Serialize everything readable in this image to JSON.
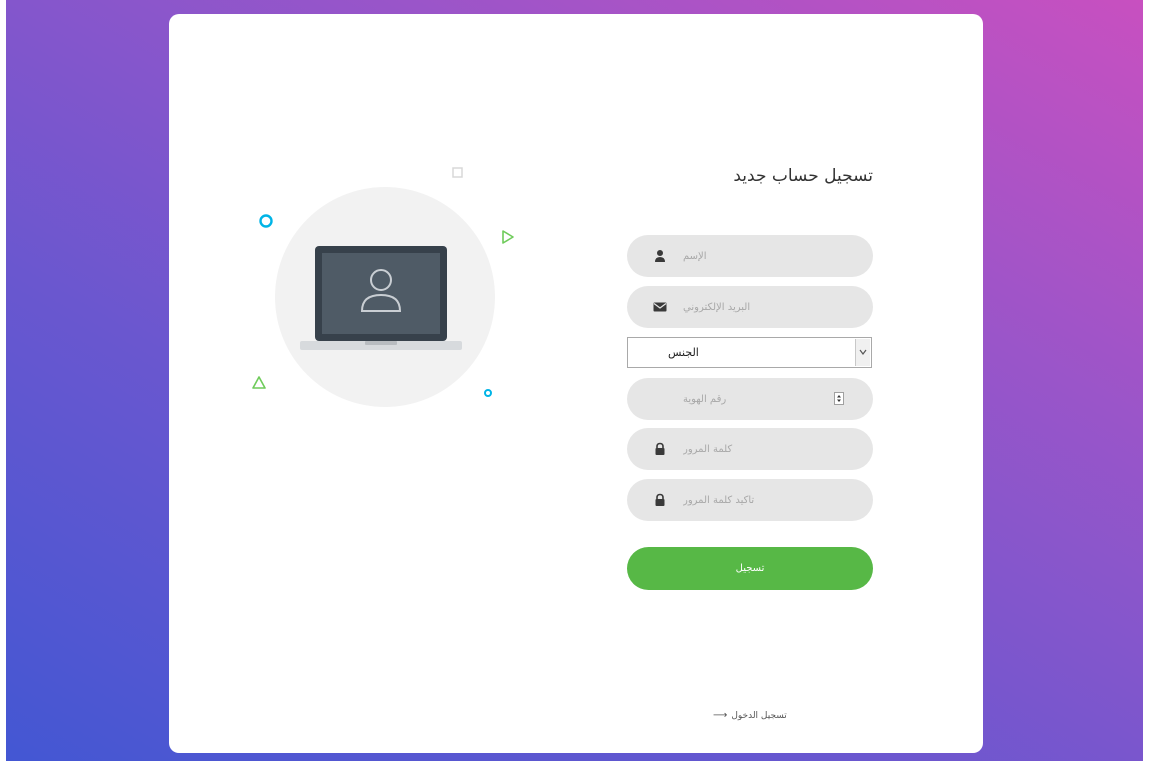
{
  "form": {
    "title": "تسجيل حساب جديد",
    "name_placeholder": "الإسم",
    "email_placeholder": "البريد الإلكتروني",
    "gender_selected": "الجنس",
    "id_placeholder": "رقم الهوية",
    "password_placeholder": "كلمة المرور",
    "confirm_password_placeholder": "تأكيد كلمة المرور",
    "submit_label": "تسجيل",
    "login_link_label": "تسجيل الدخول",
    "login_link_arrow": "⟶"
  },
  "colors": {
    "accent": "#57b846",
    "field_bg": "#e6e6e6",
    "gradient_start": "#4357d3",
    "gradient_end": "#c850c0",
    "decor_cyan": "#00b4e6",
    "decor_green": "#6ecb5a"
  },
  "icons": {
    "name_field": "user-icon",
    "email_field": "envelope-icon",
    "password_field": "lock-icon",
    "confirm_password_field": "lock-icon",
    "illustration": "laptop-user-icon"
  }
}
